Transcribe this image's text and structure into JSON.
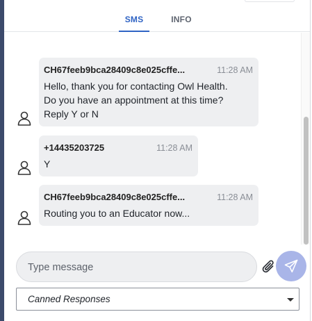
{
  "tabs": [
    {
      "label": "SMS",
      "active": true
    },
    {
      "label": "INFO",
      "active": false
    }
  ],
  "messages": [
    {
      "sender": "CH67feeb9bca28409c8e025cffe...",
      "time": "11:28 AM",
      "lines": [
        "Hello, thank you for contacting Owl Health.",
        "Do you have an appointment at this time?",
        "Reply Y or N"
      ],
      "avatar_icon": "person-icon"
    },
    {
      "sender": "+14435203725",
      "time": "11:28 AM",
      "lines": [
        "Y"
      ],
      "avatar_icon": "person-icon"
    },
    {
      "sender": "CH67feeb9bca28409c8e025cffe...",
      "time": "11:28 AM",
      "lines": [
        "Routing you to an Educator now..."
      ],
      "avatar_icon": "person-icon"
    }
  ],
  "composer": {
    "placeholder": "Type message",
    "value": "",
    "attach_icon": "paperclip-icon",
    "send_icon": "send-icon"
  },
  "canned": {
    "label": "Canned Responses"
  },
  "colors": {
    "accent": "#2f63c4",
    "send_button": "#a9b5e8",
    "bubble": "#eeeff1",
    "left_strip": "#3c4a6b"
  }
}
